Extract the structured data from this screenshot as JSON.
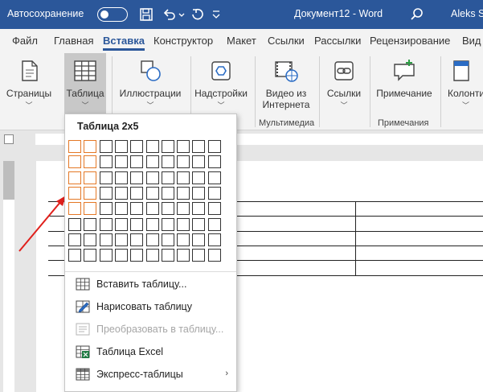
{
  "titlebar": {
    "autosave": "Автосохранение",
    "document": "Документ12",
    "separator": "-",
    "app": "Word",
    "user": "Aleks St"
  },
  "tabs": [
    "Файл",
    "Главная",
    "Вставка",
    "Конструктор",
    "Макет",
    "Ссылки",
    "Рассылки",
    "Рецензирование",
    "Вид"
  ],
  "active_tab": "Вставка",
  "ribbon": {
    "pages": "Страницы",
    "table": "Таблица",
    "illustrations": "Иллюстрации",
    "addins": "Надстройки",
    "video_line1": "Видео из",
    "video_line2": "Интернета",
    "links": "Ссылки",
    "comment": "Примечание",
    "header_footer": "Колонти",
    "group_media": "Мультимедиа",
    "group_comments": "Примечания"
  },
  "table_menu": {
    "title": "Таблица 2x5",
    "grid_columns": 10,
    "grid_rows": 8,
    "selected_columns": 2,
    "selected_rows": 5,
    "highlight_color": "#e47826",
    "items": [
      {
        "label": "Вставить таблицу...",
        "icon": "insert-table-icon",
        "enabled": true,
        "submenu": false
      },
      {
        "label": "Нарисовать таблицу",
        "icon": "draw-table-icon",
        "enabled": true,
        "submenu": false
      },
      {
        "label": "Преобразовать в таблицу...",
        "icon": "convert-to-table-icon",
        "enabled": false,
        "submenu": false
      },
      {
        "label": "Таблица Excel",
        "icon": "excel-table-icon",
        "enabled": true,
        "submenu": false
      },
      {
        "label": "Экспресс-таблицы",
        "icon": "quick-tables-icon",
        "enabled": true,
        "submenu": true
      }
    ],
    "submenu_arrow": "›"
  },
  "colors": {
    "titlebar": "#2b579a",
    "arrow": "#e0201c"
  }
}
